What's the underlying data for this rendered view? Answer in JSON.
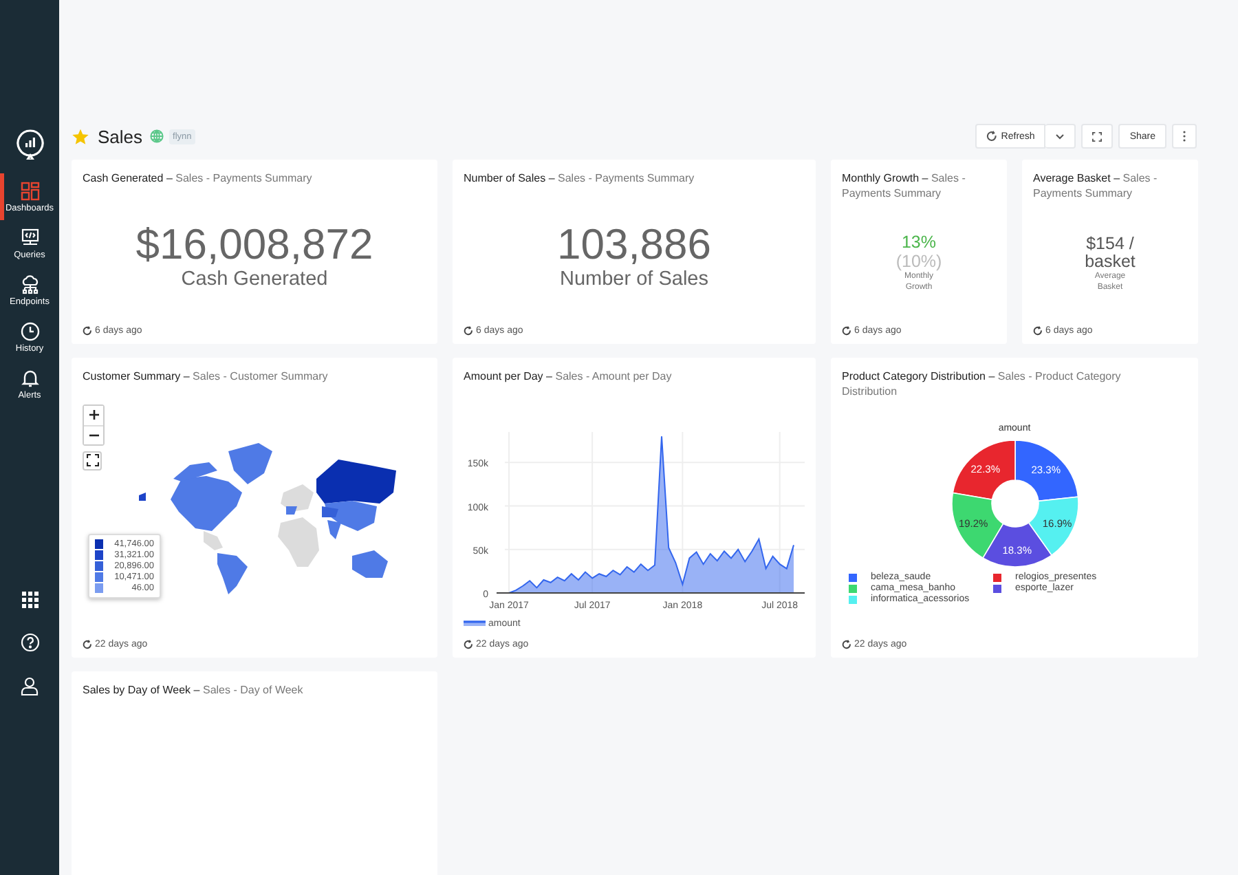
{
  "sidebar": {
    "nav": [
      {
        "kind": "dashboards",
        "label": "Dashboards",
        "selected": true
      },
      {
        "kind": "queries",
        "label": "Queries",
        "selected": false
      },
      {
        "kind": "endpoints",
        "label": "Endpoints",
        "selected": false
      },
      {
        "kind": "history",
        "label": "History",
        "selected": false
      },
      {
        "kind": "alerts",
        "label": "Alerts",
        "selected": false
      }
    ]
  },
  "header": {
    "title": "Sales",
    "favorite": true,
    "tag": "flynn",
    "buttons": [
      {
        "kind": "refresh",
        "label": "Refresh"
      },
      {
        "kind": "caret"
      },
      {
        "kind": "fullscreen"
      },
      {
        "kind": "text",
        "label": "Share"
      },
      {
        "kind": "more"
      }
    ]
  },
  "widgets": [
    {
      "kind": "counter",
      "title": "Cash Generated",
      "dash": "–",
      "query": "Sales - Payments Summary",
      "value": "$16,008,872",
      "label": "Cash Generated",
      "updated": "6 days ago"
    },
    {
      "kind": "counter",
      "title": "Number of Sales",
      "dash": "–",
      "query": "Sales - Payments Summary",
      "value": "103,886",
      "label": "Number of Sales",
      "updated": "6 days ago"
    },
    {
      "kind": "small-counter",
      "title": "Monthly Growth",
      "dash": "–",
      "query": "Sales - Payments Summary",
      "value": "13%",
      "positive": true,
      "target": "(10%)",
      "label": "Monthly Growth",
      "updated": "6 days ago"
    },
    {
      "kind": "small-counter",
      "title": "Average Basket",
      "dash": "–",
      "query": "Sales - Payments Summary",
      "value": "$154 / basket",
      "positive": false,
      "label": "Average Basket",
      "updated": "6 days ago"
    },
    {
      "kind": "map",
      "title": "Customer Summary",
      "dash": "–",
      "query": "Sales - Customer Summary",
      "legend": [
        {
          "label": "41,746.00",
          "color": "#0a2fb0"
        },
        {
          "label": "31,321.00",
          "color": "#1d44c8"
        },
        {
          "label": "20,896.00",
          "color": "#3560d8"
        },
        {
          "label": "10,471.00",
          "color": "#4f7ae6"
        },
        {
          "label": "46.00",
          "color": "#7a9cf0"
        }
      ],
      "updated": "22 days ago"
    },
    {
      "kind": "area",
      "title": "Amount per Day",
      "dash": "–",
      "query": "Sales - Amount per Day",
      "updated": "22 days ago",
      "chart_data": {
        "type": "area",
        "categories": [
          "Jan 2017",
          null,
          null,
          null,
          null,
          null,
          null,
          null,
          null,
          null,
          null,
          null,
          "Jul 2017",
          null,
          null,
          null,
          null,
          null,
          null,
          null,
          null,
          null,
          null,
          null,
          null,
          "Jan 2018",
          null,
          null,
          null,
          null,
          null,
          null,
          null,
          null,
          null,
          null,
          null,
          null,
          null,
          "Jul 2018",
          null,
          null
        ],
        "series": [
          {
            "name": "amount",
            "color": "#3366ee",
            "values": [
              0,
              3000,
              8000,
              14000,
              6000,
              15000,
              12000,
              18000,
              14000,
              22000,
              15000,
              24000,
              17000,
              22000,
              19000,
              26000,
              21000,
              30000,
              24000,
              33000,
              26000,
              32000,
              180000,
              52000,
              35000,
              10000,
              40000,
              47000,
              33000,
              45000,
              37000,
              48000,
              40000,
              50000,
              36000,
              48000,
              62000,
              28000,
              42000,
              33000,
              28000,
              55000
            ]
          }
        ],
        "legend": true,
        "grid": true,
        "ylim": [
          0,
          185000
        ],
        "yticks": [
          {
            "value": 0,
            "label": "0"
          },
          {
            "value": 50000,
            "label": "50k"
          },
          {
            "value": 100000,
            "label": "100k"
          },
          {
            "value": 150000,
            "label": "150k"
          }
        ]
      }
    },
    {
      "kind": "donut",
      "title": "Product Category Distribution",
      "dash": "–",
      "query": "Sales - Product Category Distribution",
      "updated": "22 days ago",
      "chart_data": {
        "type": "donut",
        "title": "amount",
        "legend": true,
        "categories": [
          "beleza_saude",
          "relogios_presentes",
          "cama_mesa_banho",
          "esporte_lazer",
          "informatica_acessorios"
        ],
        "series": [
          {
            "values": [
              23.3,
              22.3,
              19.2,
              18.3,
              16.9
            ]
          }
        ],
        "colors": [
          "#3366ff",
          "#e8262e",
          "#3dd870",
          "#5b4ee0",
          "#55f0f0"
        ],
        "value_labels": [
          "23.3%",
          "22.3%",
          "19.2%",
          "18.3%",
          "16.9%"
        ]
      }
    },
    {
      "kind": "empty",
      "title": "Sales by Day of Week",
      "dash": "–",
      "query": "Sales - Day of Week"
    }
  ]
}
